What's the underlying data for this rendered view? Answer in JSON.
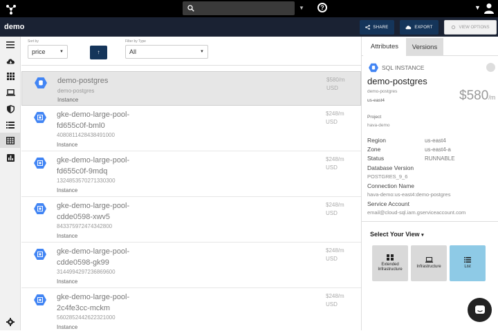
{
  "topbar": {
    "icons": [
      "logo-icon",
      "search-icon",
      "chevron-down-icon",
      "help-icon",
      "user-icon"
    ],
    "help_glyph": "?"
  },
  "header": {
    "title": "demo",
    "share_label": "SHARE",
    "export_label": "EXPORT",
    "view_options_label": "VIEW OPTIONS"
  },
  "sidebar": {
    "items": [
      "menu-icon",
      "cloud-icon",
      "apps-grid-icon",
      "laptop-icon",
      "shield-icon",
      "list-icon",
      "table-icon",
      "bar-chart-icon",
      "gear-icon"
    ],
    "active_index": 6
  },
  "filters": {
    "sort_label": "Sort by",
    "sort_value": "price",
    "sort_direction_glyph": "↑",
    "type_label": "Filter by Type",
    "type_value": "All"
  },
  "list": [
    {
      "name_line1": "demo-postgres",
      "name_line2": "",
      "sub": "demo-postgres",
      "type": "Instance",
      "price": "$580/m",
      "currency": "USD",
      "icon": "sql-hex-icon",
      "selected": true
    },
    {
      "name_line1": "gke-demo-large-pool-",
      "name_line2": "fd655c0f-bml0",
      "sub": "4080811428438491000",
      "type": "Instance",
      "price": "$248/m",
      "currency": "USD",
      "icon": "compute-hex-icon",
      "selected": false
    },
    {
      "name_line1": "gke-demo-large-pool-",
      "name_line2": "fd655c0f-9mdq",
      "sub": "1324853570271330300",
      "type": "Instance",
      "price": "$248/m",
      "currency": "USD",
      "icon": "compute-hex-icon",
      "selected": false
    },
    {
      "name_line1": "gke-demo-large-pool-",
      "name_line2": "cdde0598-xwv5",
      "sub": "843375972474342800",
      "type": "Instance",
      "price": "$248/m",
      "currency": "USD",
      "icon": "compute-hex-icon",
      "selected": false
    },
    {
      "name_line1": "gke-demo-large-pool-",
      "name_line2": "cdde0598-gk99",
      "sub": "3144994297236869600",
      "type": "Instance",
      "price": "$248/m",
      "currency": "USD",
      "icon": "compute-hex-icon",
      "selected": false
    },
    {
      "name_line1": "gke-demo-large-pool-",
      "name_line2": "2c4fe3cc-mckm",
      "sub": "5602852442622321000",
      "type": "Instance",
      "price": "$248/m",
      "currency": "USD",
      "icon": "compute-hex-icon",
      "selected": false
    }
  ],
  "panel": {
    "tabs": [
      "Attributes",
      "Versions"
    ],
    "active_tab": "Attributes",
    "kind": "SQL INSTANCE",
    "name": "demo-postgres",
    "sub1": "demo-postgres",
    "sub2": "us-east4",
    "price": "$580",
    "price_unit": "/m",
    "project_label": "Project",
    "project_value": "hava-demo",
    "attrs": [
      {
        "key": "Region",
        "value": "us-east4"
      },
      {
        "key": "Zone",
        "value": "us-east4-a"
      },
      {
        "key": "Status",
        "value": "RUNNABLE"
      }
    ],
    "db_version_label": "Database Version",
    "db_version_value": "POSTGRES_9_6",
    "connection_label": "Connection Name",
    "connection_value": "hava-demo:us-east4:demo-postgres",
    "service_label": "Service Account",
    "service_value": "email@cloud-sql.iam.gserviceaccount.com",
    "select_view_label": "Select Your View",
    "views": [
      {
        "line1": "Extended",
        "line2": "Infrastructure",
        "icon": "extended-infrastructure-icon",
        "color": "#d9d9d9"
      },
      {
        "line1": "Infrastructure",
        "line2": "",
        "icon": "laptop-icon",
        "color": "#d9d9d9"
      },
      {
        "line1": "List",
        "line2": "",
        "icon": "list-icon",
        "color": "#8ecae6"
      }
    ]
  },
  "colors": {
    "topbar": "#000000",
    "subbar": "#1a2233",
    "button": "#15355a",
    "hex": "#4285f4",
    "selected_row": "#e6e6e6",
    "active_view": "#8ecae6"
  },
  "chat": {
    "icon": "chat-icon"
  }
}
